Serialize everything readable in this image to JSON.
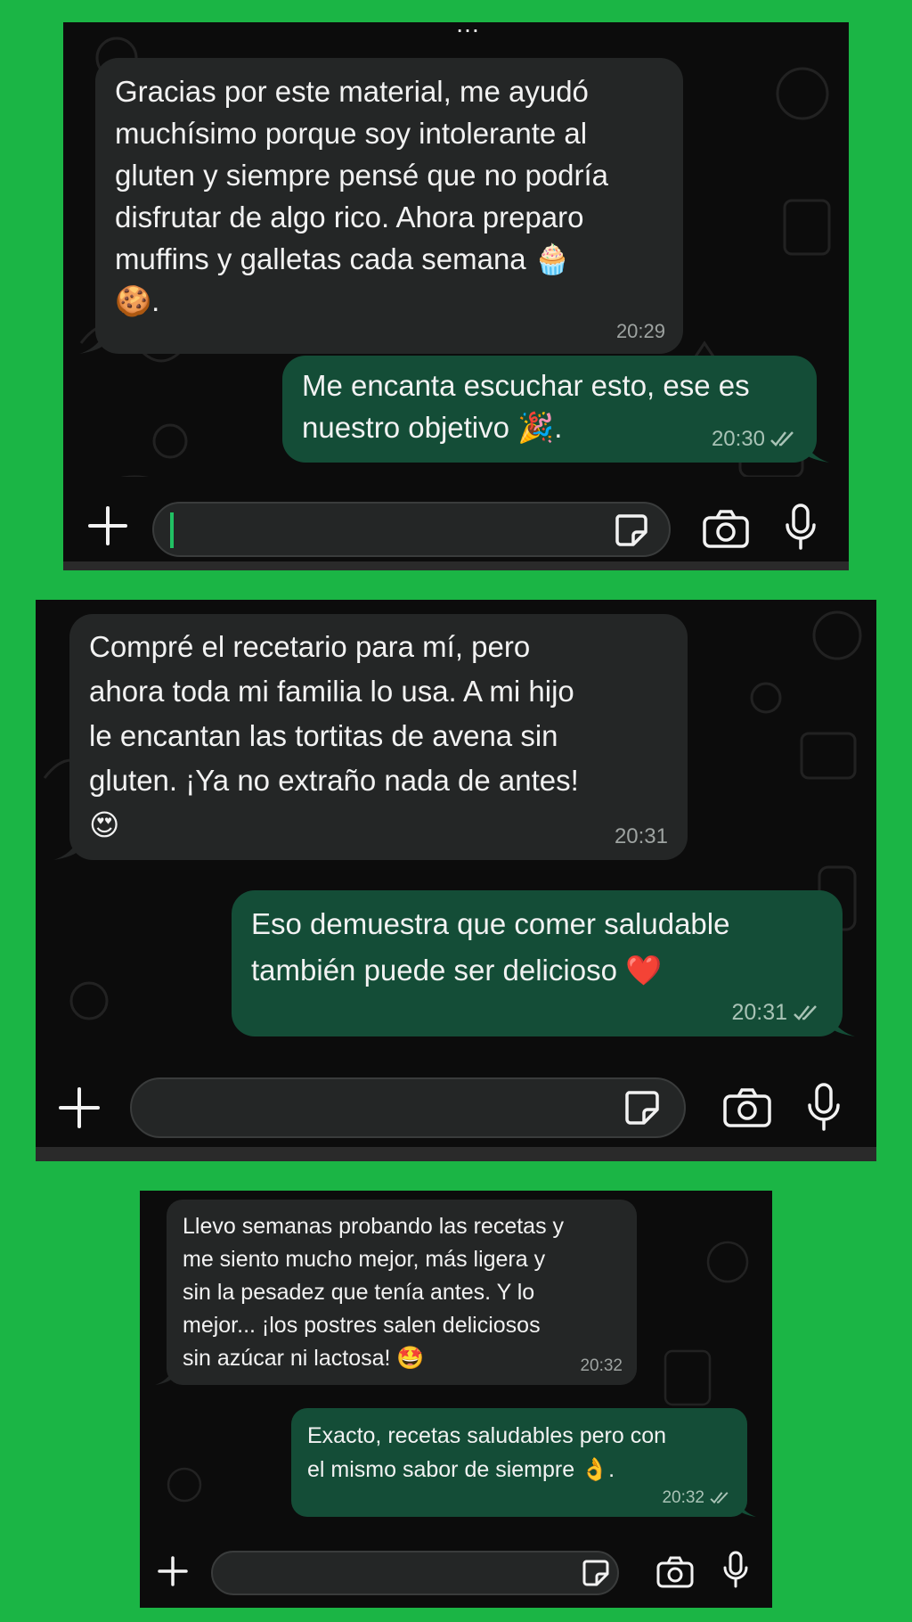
{
  "colors": {
    "page_background": "#1bb545",
    "chat_background": "#0c0c0c",
    "incoming_bubble": "#242626",
    "outgoing_bubble": "#144d37",
    "text": "#f2f2f2",
    "timestamp": "#9ea3a1",
    "caret": "#21c063"
  },
  "screenshots": [
    {
      "top_partial_text": "…",
      "messages": [
        {
          "direction": "incoming",
          "text": "Gracias por este material, me ayudó\nmuchísimo porque soy intolerante al\ngluten y siempre pensé que no podría\ndisfrutar de algo rico. Ahora preparo\nmuffins y galletas cada semana 🧁\n🍪.",
          "time": "20:29"
        },
        {
          "direction": "outgoing",
          "text": "Me encanta escuchar esto, ese es\nnuestro objetivo 🎉.",
          "time": "20:30",
          "status_icon": "double-check-icon"
        }
      ],
      "input": {
        "value": "",
        "placeholder": ""
      }
    },
    {
      "messages": [
        {
          "direction": "incoming",
          "text": "Compré el recetario para mí, pero\nahora toda mi familia lo usa. A mi hijo\nle encantan las tortitas de avena sin\ngluten. ¡Ya no extraño nada de antes!\n😍",
          "time": "20:31"
        },
        {
          "direction": "outgoing",
          "text": "Eso demuestra que comer saludable\ntambién puede ser delicioso ❤️",
          "time": "20:31",
          "status_icon": "double-check-icon"
        }
      ],
      "input": {
        "value": "",
        "placeholder": ""
      }
    },
    {
      "messages": [
        {
          "direction": "incoming",
          "text": "Llevo semanas probando las recetas y\nme siento mucho mejor, más ligera y\nsin la pesadez que tenía antes. Y lo\nmejor... ¡los postres salen deliciosos\nsin azúcar ni lactosa! 🤩",
          "time": "20:32"
        },
        {
          "direction": "outgoing",
          "text": "Exacto, recetas saludables pero con\nel mismo sabor de siempre 👌.",
          "time": "20:32",
          "status_icon": "double-check-icon"
        }
      ],
      "input": {
        "value": "",
        "placeholder": ""
      }
    }
  ],
  "icons": [
    "plus-icon",
    "sticker-icon",
    "camera-icon",
    "microphone-icon",
    "double-check-icon"
  ]
}
